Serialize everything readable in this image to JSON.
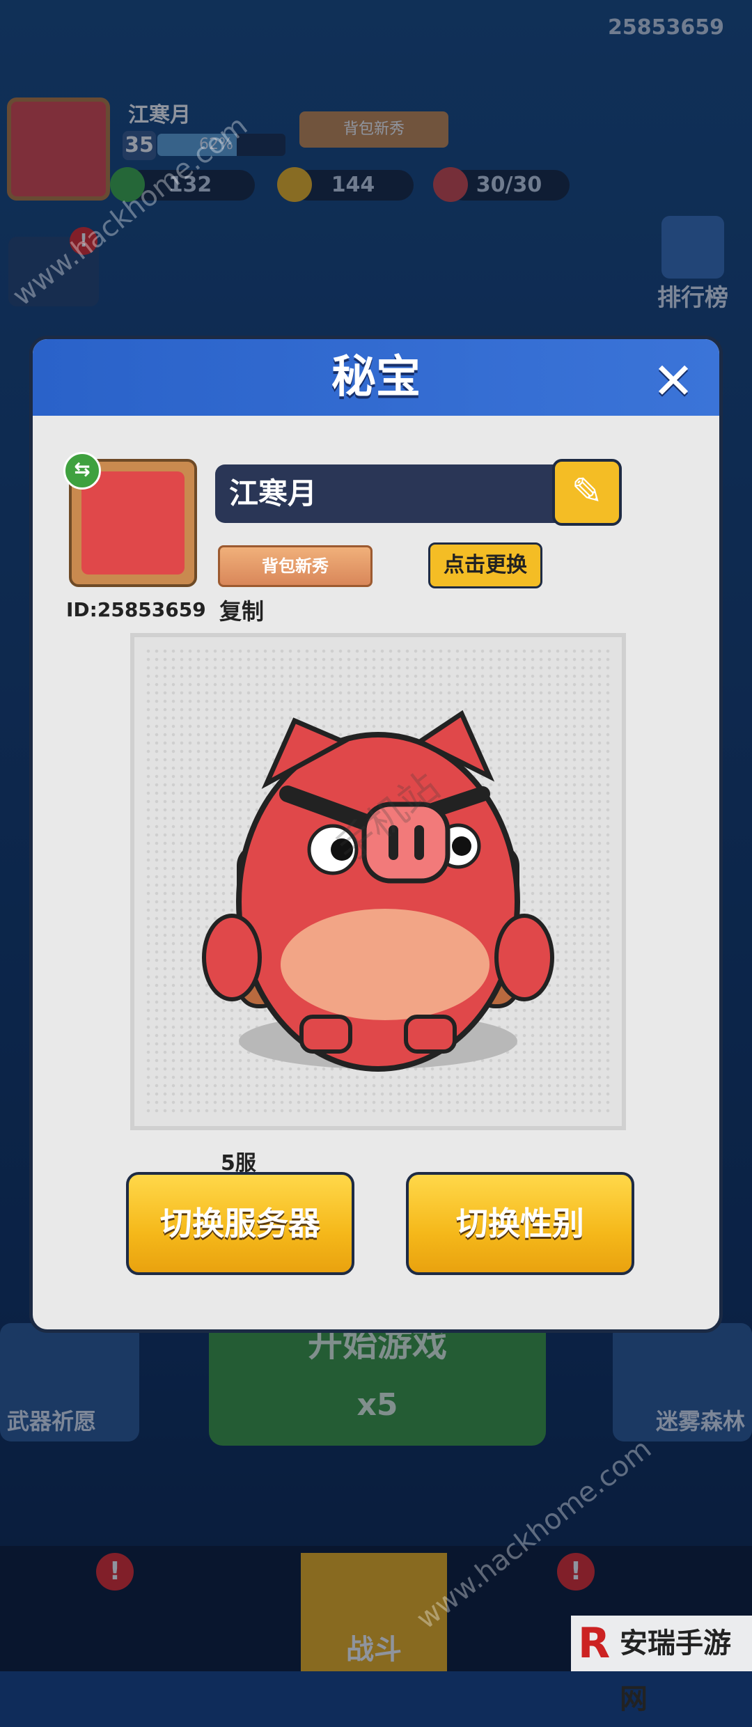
{
  "topbar": {
    "player_id": "25853659",
    "player_name": "江寒月",
    "level": "35",
    "xp_percent": "62%",
    "xp_fraction": 0.62,
    "title": "背包新秀",
    "gems": "132",
    "coins": "144",
    "stamina": "30/30"
  },
  "side": {
    "rank_label": "排行榜",
    "weapon_label": "武器祈愿",
    "forest_label": "迷雾森林"
  },
  "start": {
    "label": "开始游戏",
    "cost": "x5"
  },
  "bottom_nav": {
    "battle_label": "战斗",
    "badge": "!"
  },
  "modal": {
    "title": "秘宝",
    "close": "✕",
    "name": "江寒月",
    "id_text": "ID:25853659",
    "copy_label": "复制",
    "title_badge": "背包新秀",
    "change_label": "点击更换",
    "server_label": "5服",
    "switch_server_label": "切换服务器",
    "switch_gender_label": "切换性别"
  },
  "watermarks": {
    "site": "www.hackhome.com",
    "site2": "www.hackhome.com",
    "center": "手机站",
    "logo": "安瑞手游网"
  },
  "colors": {
    "header_blue": "#2a62c9",
    "button_yellow": "#f5b81a",
    "pig_red": "#e0484a"
  }
}
